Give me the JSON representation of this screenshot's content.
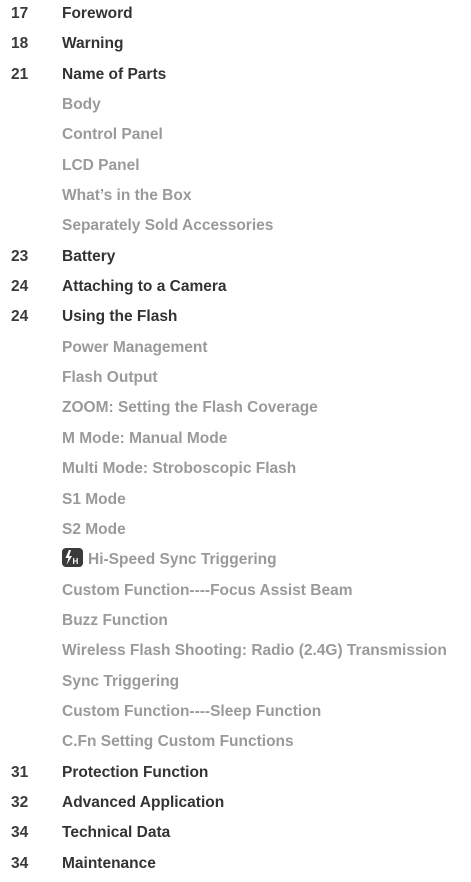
{
  "entries": [
    {
      "page": "17",
      "title": "Foreword",
      "level": "main"
    },
    {
      "page": "18",
      "title": "Warning",
      "level": "main"
    },
    {
      "page": "21",
      "title": "Name of Parts",
      "level": "main"
    },
    {
      "page": "",
      "title": "Body",
      "level": "sub"
    },
    {
      "page": "",
      "title": "Control Panel",
      "level": "sub"
    },
    {
      "page": "",
      "title": "LCD Panel",
      "level": "sub"
    },
    {
      "page": "",
      "title": "What’s in the Box",
      "level": "sub"
    },
    {
      "page": "",
      "title": "Separately Sold Accessories",
      "level": "sub"
    },
    {
      "page": "23",
      "title": "Battery",
      "level": "main"
    },
    {
      "page": "24",
      "title": "Attaching to a Camera",
      "level": "main"
    },
    {
      "page": "24",
      "title": "Using the Flash",
      "level": "main"
    },
    {
      "page": "",
      "title": "Power Management",
      "level": "sub"
    },
    {
      "page": "",
      "title": "Flash Output",
      "level": "sub"
    },
    {
      "page": "",
      "title": "ZOOM: Setting the Flash Coverage",
      "level": "sub"
    },
    {
      "page": "",
      "title": "M Mode: Manual Mode",
      "level": "sub"
    },
    {
      "page": "",
      "title": "Multi Mode: Stroboscopic Flash",
      "level": "sub"
    },
    {
      "page": "",
      "title": "S1 Mode",
      "level": "sub"
    },
    {
      "page": "",
      "title": "S2 Mode",
      "level": "sub"
    },
    {
      "page": "",
      "title": "Hi-Speed Sync Triggering",
      "level": "sub",
      "icon": "high-speed-sync-icon"
    },
    {
      "page": "",
      "title": "Custom Function----Focus Assist Beam",
      "level": "sub"
    },
    {
      "page": "",
      "title": "Buzz Function",
      "level": "sub"
    },
    {
      "page": "",
      "title": "Wireless Flash Shooting: Radio (2.4G) Transmission",
      "level": "sub"
    },
    {
      "page": "",
      "title": "Sync Triggering",
      "level": "sub"
    },
    {
      "page": "",
      "title": "Custom Function----Sleep Function",
      "level": "sub"
    },
    {
      "page": "",
      "title": "C.Fn Setting Custom Functions",
      "level": "sub"
    },
    {
      "page": "31",
      "title": "Protection Function",
      "level": "main"
    },
    {
      "page": "32",
      "title": "Advanced Application",
      "level": "main"
    },
    {
      "page": "34",
      "title": "Technical Data",
      "level": "main"
    },
    {
      "page": "34",
      "title": "Maintenance",
      "level": "main"
    }
  ],
  "colors": {
    "main_text": "#333333",
    "sub_text": "#9a9a9a",
    "page_number": "#3a3a3a"
  }
}
